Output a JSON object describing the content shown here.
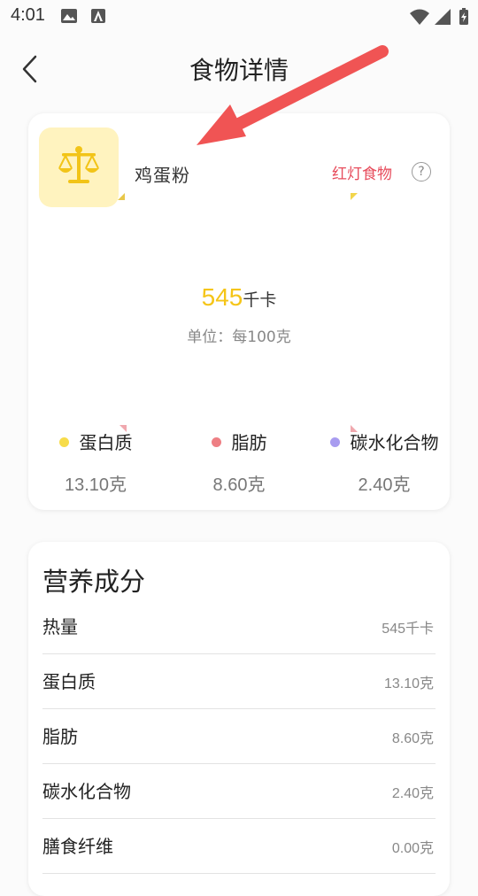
{
  "status_bar": {
    "time": "4:01"
  },
  "header": {
    "title": "食物详情"
  },
  "food": {
    "name": "鸡蛋粉",
    "rating_label": "红灯食物",
    "help_symbol": "?",
    "calorie_value": "545",
    "calorie_unit": "千卡",
    "unit_note": "单位：每100克",
    "icon": "scale-icon",
    "macros": [
      {
        "name": "蛋白质",
        "value": "13.10克",
        "color": "#f7dc4a"
      },
      {
        "name": "脂肪",
        "value": "8.60克",
        "color": "#ee7f84"
      },
      {
        "name": "碳水化合物",
        "value": "2.40克",
        "color": "#a89cf0"
      }
    ]
  },
  "nutrition": {
    "title": "营养成分",
    "rows": [
      {
        "label": "热量",
        "value": "545千卡"
      },
      {
        "label": "蛋白质",
        "value": "13.10克"
      },
      {
        "label": "脂肪",
        "value": "8.60克"
      },
      {
        "label": "碳水化合物",
        "value": "2.40克"
      },
      {
        "label": "膳食纤维",
        "value": "0.00克"
      }
    ]
  },
  "colors": {
    "accent_yellow": "#f5c518",
    "red_label": "#e74c5c",
    "arrow": "#f05454"
  }
}
